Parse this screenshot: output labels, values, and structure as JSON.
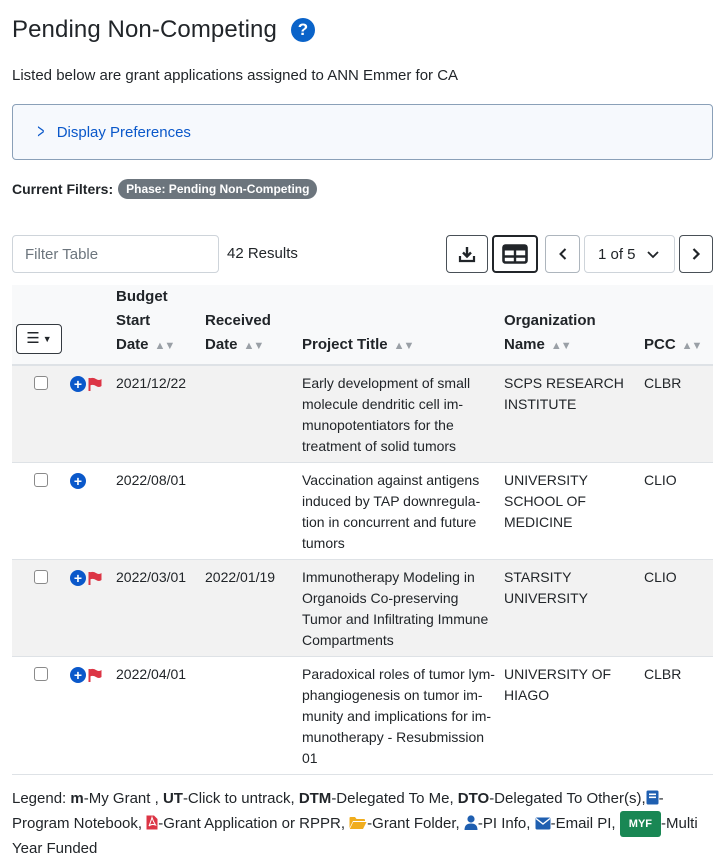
{
  "page": {
    "title": "Pending Non-Competing",
    "intro": "Listed below are grant applications assigned to ANN Emmer for CA"
  },
  "preferences": {
    "label": "Display Preferences"
  },
  "filters": {
    "label": "Current Filters:",
    "badge": "Phase: Pending Non-Competing"
  },
  "toolbar": {
    "filter_placeholder": "Filter Table",
    "results": "42 Results",
    "page_display": "1 of 5"
  },
  "table": {
    "headers": {
      "budget_start_1": "Budget",
      "budget_start_2": "Start",
      "budget_start_3": "Date",
      "received_1": "Received",
      "received_2": "Date",
      "project_title": "Project Title",
      "organization_1": "Organization",
      "organization_2": "Name",
      "pcc": "PCC"
    },
    "rows": [
      {
        "budget_start": "2021/12/22",
        "received": "",
        "title": "Early development of small molecule dendritic cell im-munopotentiators for the treatment of solid tumors",
        "org": "SCPS RESEARCH INSTITUTE",
        "pcc": "CLBR",
        "flag": true
      },
      {
        "budget_start": "2022/08/01",
        "received": "",
        "title": "Vaccination against antigens induced by TAP downregula-tion in concurrent and future tumors",
        "org": "UNIVERSITY SCHOOL OF MEDICINE",
        "pcc": "CLIO",
        "flag": false
      },
      {
        "budget_start": "2022/03/01",
        "received": "2022/01/19",
        "title": "Immunotherapy Modeling in Organoids Co-preserving Tumor and Infiltrating Immune Compartments",
        "org": "STARSITY UNIVERSITY",
        "pcc": "CLIO",
        "flag": true
      },
      {
        "budget_start": "2022/04/01",
        "received": "",
        "title": "Paradoxical roles of tumor lym-phangiogenesis on tumor im-munity and implications for im-munotherapy - Resubmission 01",
        "org": "UNIVERSITY OF HIAGO",
        "pcc": "CLBR",
        "flag": true
      }
    ]
  },
  "legend": {
    "prefix": "Legend:",
    "m_key": "m",
    "m_text": "-My Grant ,",
    "ut_key": "UT",
    "ut_text": "-Click to untrack,",
    "dtm_key": "DTM",
    "dtm_text": "-Delegated To Me,",
    "dto_key": "DTO",
    "dto_text": "-Delegated To Other(s),",
    "notebook_text": "-Program Notebook,",
    "pdf_text": "-Grant Application or RPPR,",
    "folder_text": "-Grant Folder,",
    "pi_text": "-PI Info,",
    "email_text": "-Email PI,",
    "myf_badge": "MYF",
    "myf_text": "-Multi Year Funded"
  },
  "colors": {
    "accent": "#0a58ca",
    "flag": "#dc3545",
    "folder": "#f0ad1e",
    "myf": "#198754",
    "badge": "#6c757d"
  }
}
